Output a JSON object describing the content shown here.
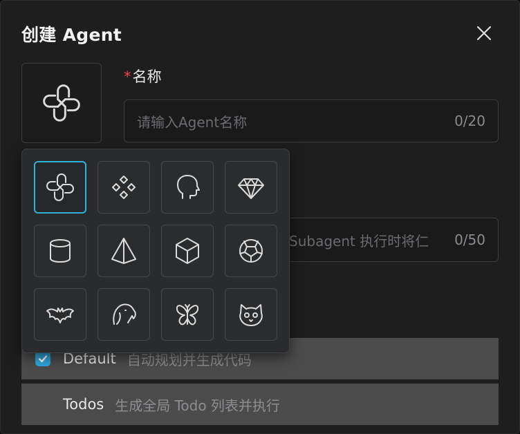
{
  "dialog": {
    "title": "创建 Agent"
  },
  "form": {
    "name_required_mark": "*",
    "name_label": "名称",
    "name_placeholder": "请输入Agent名称",
    "name_counter": "0/20",
    "desc_placeholder": "Subagent 执行时将仁",
    "desc_counter": "0/50"
  },
  "avatar": {
    "selected_icon": "knot-icon"
  },
  "icon_picker": {
    "icons": [
      "knot-icon",
      "diamond-cluster-icon",
      "head-icon",
      "gem-icon",
      "cylinder-icon",
      "pyramid-icon",
      "cube-icon",
      "sphere-icon",
      "bat-icon",
      "eagle-icon",
      "butterfly-icon",
      "cat-icon"
    ],
    "selected_index": 0
  },
  "modes": [
    {
      "name": "Default",
      "description": "自动规划并生成代码",
      "checked": true
    },
    {
      "name": "Todos",
      "description": "生成全局 Todo 列表并执行",
      "checked": false
    }
  ],
  "colors": {
    "accent": "#2fb2d8",
    "required": "#e5484d",
    "background": "#1e1e1f"
  }
}
